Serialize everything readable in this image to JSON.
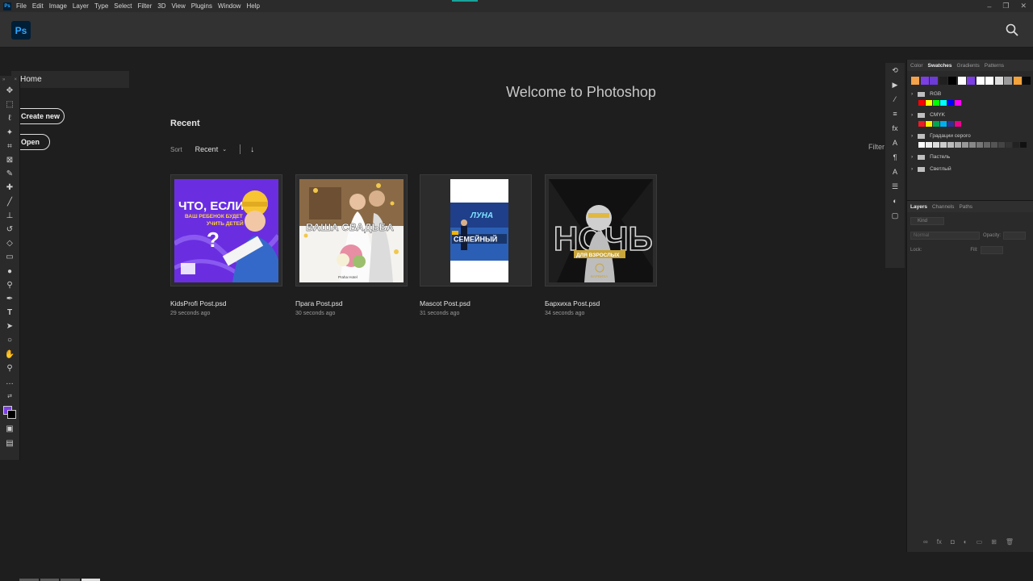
{
  "menubar": {
    "app_badge": "Ps",
    "items": [
      "File",
      "Edit",
      "Image",
      "Layer",
      "Type",
      "Select",
      "Filter",
      "3D",
      "View",
      "Plugins",
      "Window",
      "Help"
    ],
    "window_controls": [
      "–",
      "❐",
      "✕"
    ]
  },
  "header": {
    "logo": "Ps",
    "icons": [
      "search-icon"
    ]
  },
  "left_panel": {
    "home_label": "Home",
    "create_new_label": "Create new",
    "open_label": "Open"
  },
  "welcome": {
    "title": "Welcome to Photoshop"
  },
  "recent": {
    "title": "Recent",
    "sort_label": "Sort",
    "sort_value": "Recent",
    "filter_label": "Filter",
    "files": [
      {
        "name": "KidsProfi Post.psd",
        "time": "29 seconds ago",
        "thumb_text": [
          "ЧТО, ЕСЛИ",
          "ВАШ РЕБЕНОК БУДЕТ",
          "УЧИТЬ ДЕТЕЙ",
          "?"
        ]
      },
      {
        "name": "Прага Post.psd",
        "time": "30 seconds ago",
        "thumb_text": [
          "ВАША СВАДЬБА",
          "Praha Hotel"
        ]
      },
      {
        "name": "Mascot Post.psd",
        "time": "31 seconds ago",
        "thumb_text": [
          "ЛУНА",
          "СЕМЕЙНЫЙ"
        ]
      },
      {
        "name": "Бархиха Post.psd",
        "time": "34 seconds ago",
        "thumb_text": [
          "НОЧЬ",
          "ДЛЯ ВЗРОСЛЫХ",
          "БАРВИХА"
        ]
      }
    ]
  },
  "swatches_panel": {
    "tabs": [
      "Color",
      "Swatches",
      "Gradients",
      "Patterns"
    ],
    "active_tab": "Swatches",
    "recent_colors": [
      "#f4a24b",
      "#7b3fe4",
      "#6d3bd6",
      "#202020",
      "#000000",
      "#ffffff",
      "#7b3fe4",
      "#ffffff",
      "#ffffff",
      "#dddddd",
      "#9a9a9a",
      "#f4a23a",
      "#0a0a0a"
    ],
    "groups": [
      {
        "name": "RGB",
        "colors": [
          "#ff0000",
          "#ffff00",
          "#00ff00",
          "#00ffff",
          "#0000ff",
          "#ff00ff"
        ]
      },
      {
        "name": "CMYK",
        "colors": [
          "#ed1c24",
          "#fff200",
          "#00a651",
          "#00aeef",
          "#2e3192",
          "#ec008c"
        ]
      },
      {
        "name": "Градации серого",
        "colors": [
          "#ffffff",
          "#eeeeee",
          "#dddddd",
          "#cccccc",
          "#bbbbbb",
          "#aaaaaa",
          "#999999",
          "#888888",
          "#777777",
          "#666666",
          "#555555",
          "#444444",
          "#333333",
          "#222222",
          "#111111"
        ]
      },
      {
        "name": "Пастель",
        "colors": []
      },
      {
        "name": "Светлый",
        "colors": []
      }
    ]
  },
  "layers_panel": {
    "tabs": [
      "Layers",
      "Channels",
      "Paths"
    ],
    "active_tab": "Layers",
    "kind_label": "Kind",
    "blend_mode": "Normal",
    "opacity_label": "Opacity:",
    "lock_label": "Lock:",
    "fill_label": "Fill:"
  },
  "colors": {
    "accent": "#31a8ff",
    "foreground": "#7b3fe4",
    "background": "#000000"
  }
}
